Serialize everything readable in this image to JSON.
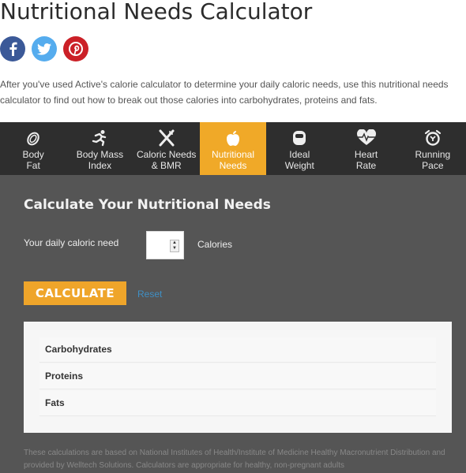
{
  "page": {
    "title": "Nutritional Needs Calculator",
    "intro": "After you've used Active's calorie calculator to determine your daily caloric needs, use this nutritional needs calculator to find out how to break out those calories into carbohydrates, proteins and fats."
  },
  "social": [
    {
      "name": "facebook",
      "icon": "facebook-icon",
      "color": "#3b5998"
    },
    {
      "name": "twitter",
      "icon": "twitter-icon",
      "color": "#55acee"
    },
    {
      "name": "pinterest",
      "icon": "pinterest-icon",
      "color": "#cb2027"
    }
  ],
  "nav": {
    "active_index": 3,
    "active_color": "#f0a928",
    "items": [
      {
        "line1": "Body",
        "line2": "Fat",
        "icon": "body-fat-icon"
      },
      {
        "line1": "Body Mass",
        "line2": "Index",
        "icon": "running-person-icon"
      },
      {
        "line1": "Caloric Needs",
        "line2": "& BMR",
        "icon": "fork-knife-icon"
      },
      {
        "line1": "Nutritional",
        "line2": "Needs",
        "icon": "apple-icon"
      },
      {
        "line1": "Ideal",
        "line2": "Weight",
        "icon": "scale-icon"
      },
      {
        "line1": "Heart",
        "line2": "Rate",
        "icon": "heart-rate-icon"
      },
      {
        "line1": "Running",
        "line2": "Pace",
        "icon": "alarm-clock-icon"
      }
    ]
  },
  "calculator": {
    "heading": "Calculate Your Nutritional Needs",
    "field_label": "Your daily caloric need",
    "field_value": "",
    "unit": "Calories",
    "calculate_label": "CALCULATE",
    "reset_label": "Reset"
  },
  "results": {
    "rows": [
      {
        "label": "Carbohydrates"
      },
      {
        "label": "Proteins"
      },
      {
        "label": "Fats"
      }
    ]
  },
  "disclaimer": "These calculations are based on National Institutes of Health/Institute of Medicine Healthy Macronutrient Distribution and provided by Welltech Solutions. Calculators are appropriate for healthy, non-pregnant adults"
}
